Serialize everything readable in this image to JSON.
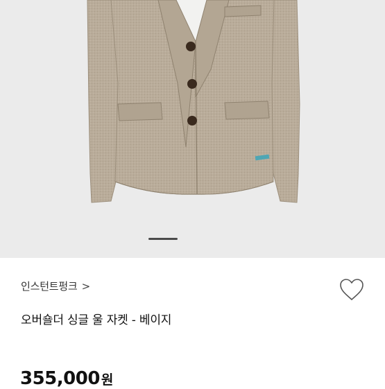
{
  "product": {
    "brand": "인스턴트펑크",
    "brand_chevron": ">",
    "name": "오버숄더 싱글 울 자켓 - 베이지",
    "price": "355,000",
    "price_unit": "원"
  },
  "gallery": {
    "image": "beige-wool-jacket",
    "indicator": "image-carousel-indicator"
  },
  "icons": {
    "wishlist": "heart-outline-icon"
  },
  "colors": {
    "jacket": "#b8ab99",
    "background": "#ebebeb",
    "buttons": "#3a2a1e"
  }
}
